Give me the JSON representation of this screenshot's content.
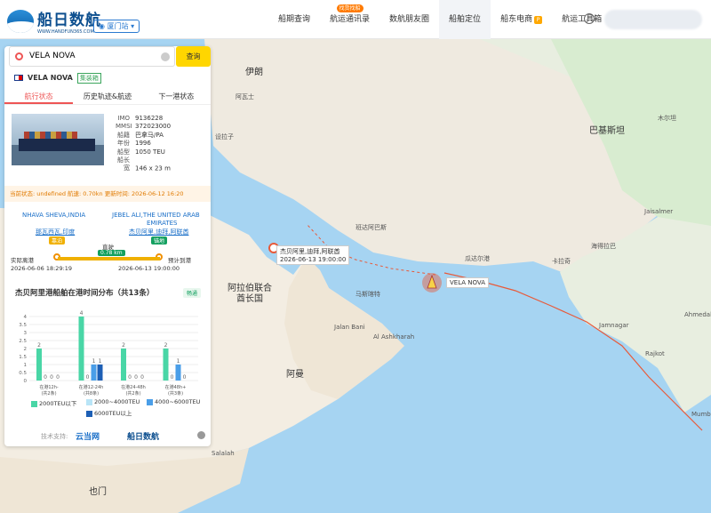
{
  "header": {
    "logo_cn": "船日数航",
    "logo_url": "WWW.HANDFUN365.COM",
    "location": "厦门站",
    "nav": [
      {
        "label": "船期查询"
      },
      {
        "label": "航运通讯录",
        "badge": "找货找船"
      },
      {
        "label": "数航朋友圈"
      },
      {
        "label": "船舶定位",
        "active": true
      },
      {
        "label": "船东电商",
        "sup": "P"
      },
      {
        "label": "航运工具箱"
      }
    ]
  },
  "search": {
    "value": "VELA NOVA",
    "button": "查询"
  },
  "ship": {
    "name": "VELA NOVA",
    "tag": "集装箱"
  },
  "tabs": [
    "航行状态",
    "历史轨迹&航迹",
    "下一港状态"
  ],
  "info": [
    {
      "k": "IMO",
      "v": "9136228"
    },
    {
      "k": "MMSI",
      "v": "372023000"
    },
    {
      "k": "船籍",
      "v": "巴拿马/PA"
    },
    {
      "k": "年份",
      "v": "1996"
    },
    {
      "k": "船型",
      "v": "1050 TEU"
    },
    {
      "k": "船长宽",
      "v": "146 x 23 m"
    }
  ],
  "status": {
    "text": "当前状态: undefined   航速: 0.70kn   更新时间: 2026-06-12 16:20"
  },
  "route": {
    "from_en": "NHAVA SHEVA,INDIA",
    "to_en": "JEBEL ALI,THE UNITED ARAB",
    "to_en2": "EMIRATES",
    "from_cn": "那瓦西瓦,印度",
    "to_cn": "杰贝阿里,迪拜,阿联酋",
    "from_pill": "靠泊",
    "to_pill": "锚地",
    "speed_label": "直驶",
    "speed": "0.78 km",
    "dep_label": "实际离港",
    "dep_time": "2026-06-06 18:29:19",
    "arr_label": "预计到港",
    "arr_time": "2026-06-13 19:00:00",
    "progress": 0.72
  },
  "chart": {
    "title": "杰贝阿里港船舶在港时间分布（共13条）",
    "btn": "畅通"
  },
  "chart_data": {
    "type": "bar",
    "categories": [
      "在港12h-\n(共2条)",
      "在港12-24h\n(共8条)",
      "在港24-48h\n(共2条)",
      "在港48h+\n(共3条)"
    ],
    "series": [
      {
        "name": "2000TEU以下",
        "values": [
          2,
          4,
          2,
          2
        ]
      },
      {
        "name": "2000~4000TEU",
        "values": [
          0,
          0,
          0,
          0
        ]
      },
      {
        "name": "4000~6000TEU",
        "values": [
          0,
          1,
          0,
          1
        ]
      },
      {
        "name": "6000TEU以上",
        "values": [
          0,
          1,
          0,
          0
        ]
      }
    ],
    "ylim": [
      0,
      4
    ],
    "yticks": [
      0,
      0.5,
      1,
      1.5,
      2,
      2.5,
      3,
      3.5,
      4
    ]
  },
  "legend": [
    "2000TEU以下",
    "2000~4000TEU",
    "4000~6000TEU",
    "6000TEU以上"
  ],
  "colors": {
    "s1": "#49d6a6",
    "s2": "#b9e5f7",
    "s3": "#4a9ee8",
    "s4": "#1d5fb5"
  },
  "footer": {
    "label": "技术支持:",
    "p1": "云当网",
    "p2": "船日数航"
  },
  "map": {
    "labels": [
      {
        "t": "伊朗",
        "big": true
      },
      {
        "t": "巴基斯坦",
        "big": true
      },
      {
        "t": "阿拉伯联合",
        "big": true
      },
      {
        "t": "酋长国",
        "big": true
      },
      {
        "t": "阿曼",
        "big": true
      },
      {
        "t": "也门",
        "big": true
      },
      {
        "t": "设拉子"
      },
      {
        "t": "阿瓦士"
      },
      {
        "t": "马斯喀特"
      },
      {
        "t": "卡拉奇"
      },
      {
        "t": "海得拉巴"
      },
      {
        "t": "木尔坦"
      },
      {
        "t": "Jaisalmer"
      },
      {
        "t": "Jamnagar"
      },
      {
        "t": "Rajkot"
      },
      {
        "t": "Ahmedal"
      },
      {
        "t": "Mumb"
      },
      {
        "t": "Salalah"
      },
      {
        "t": "Al Ashkharah"
      },
      {
        "t": "Jalan Bani"
      },
      {
        "t": "瓜达尔港"
      },
      {
        "t": "班达阿巴斯"
      }
    ],
    "port_label": "杰贝阿里,迪拜,阿联酋",
    "port_time": "2026-06-13 19:00:00",
    "ship_label": "VELA NOVA"
  }
}
